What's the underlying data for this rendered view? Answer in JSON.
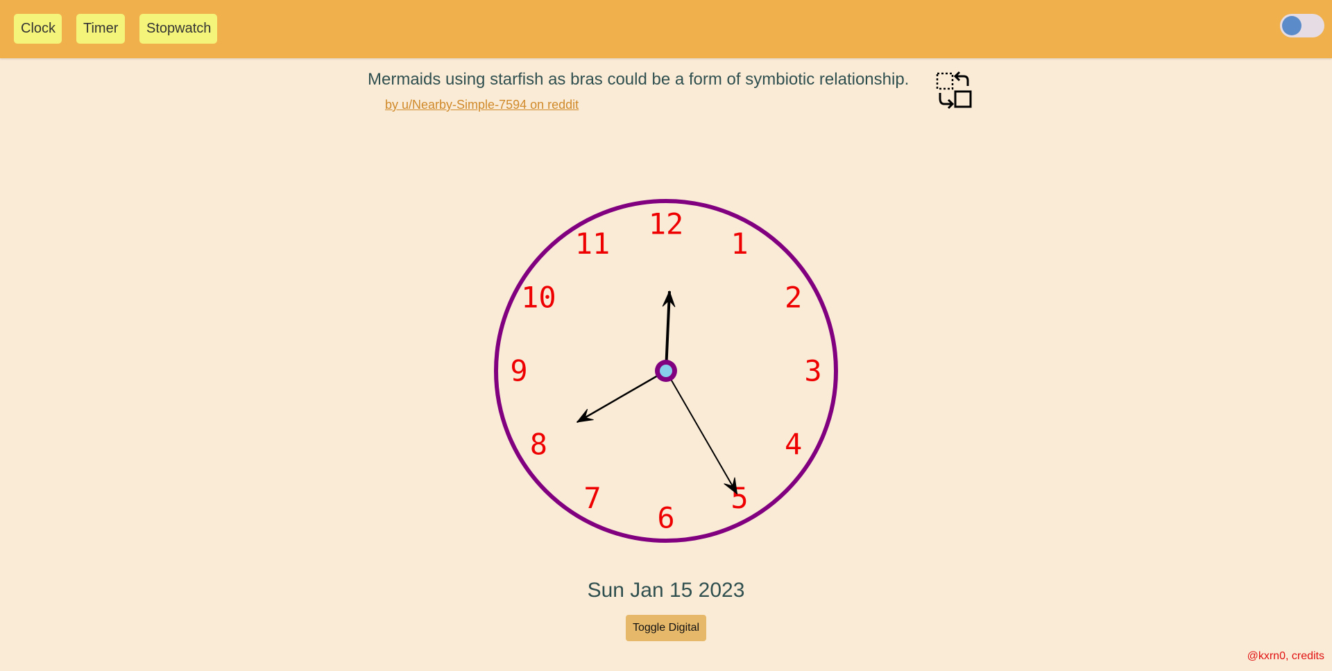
{
  "nav": {
    "clock_label": "Clock",
    "timer_label": "Timer",
    "stopwatch_label": "Stopwatch"
  },
  "theme_toggle": {
    "state": "off"
  },
  "quote": {
    "text": "Mermaids using starfish as bras could be a form of symbiotic relationship.",
    "author_link": "by u/Nearby-Simple-7594 on reddit"
  },
  "clock": {
    "numerals": [
      "12",
      "1",
      "2",
      "3",
      "4",
      "5",
      "6",
      "7",
      "8",
      "9",
      "10",
      "11"
    ],
    "time": {
      "hour": 7,
      "minute": 60,
      "second": 25
    },
    "colors": {
      "rim": "#800080",
      "numerals": "#ee0000",
      "hands": "#000000",
      "center_fill": "#87ceeb"
    }
  },
  "date": "Sun Jan 15 2023",
  "toggle_digital_label": "Toggle Digital",
  "credits": "@kxrn0, credits",
  "icons": {
    "swap": "swap-layout-icon"
  }
}
